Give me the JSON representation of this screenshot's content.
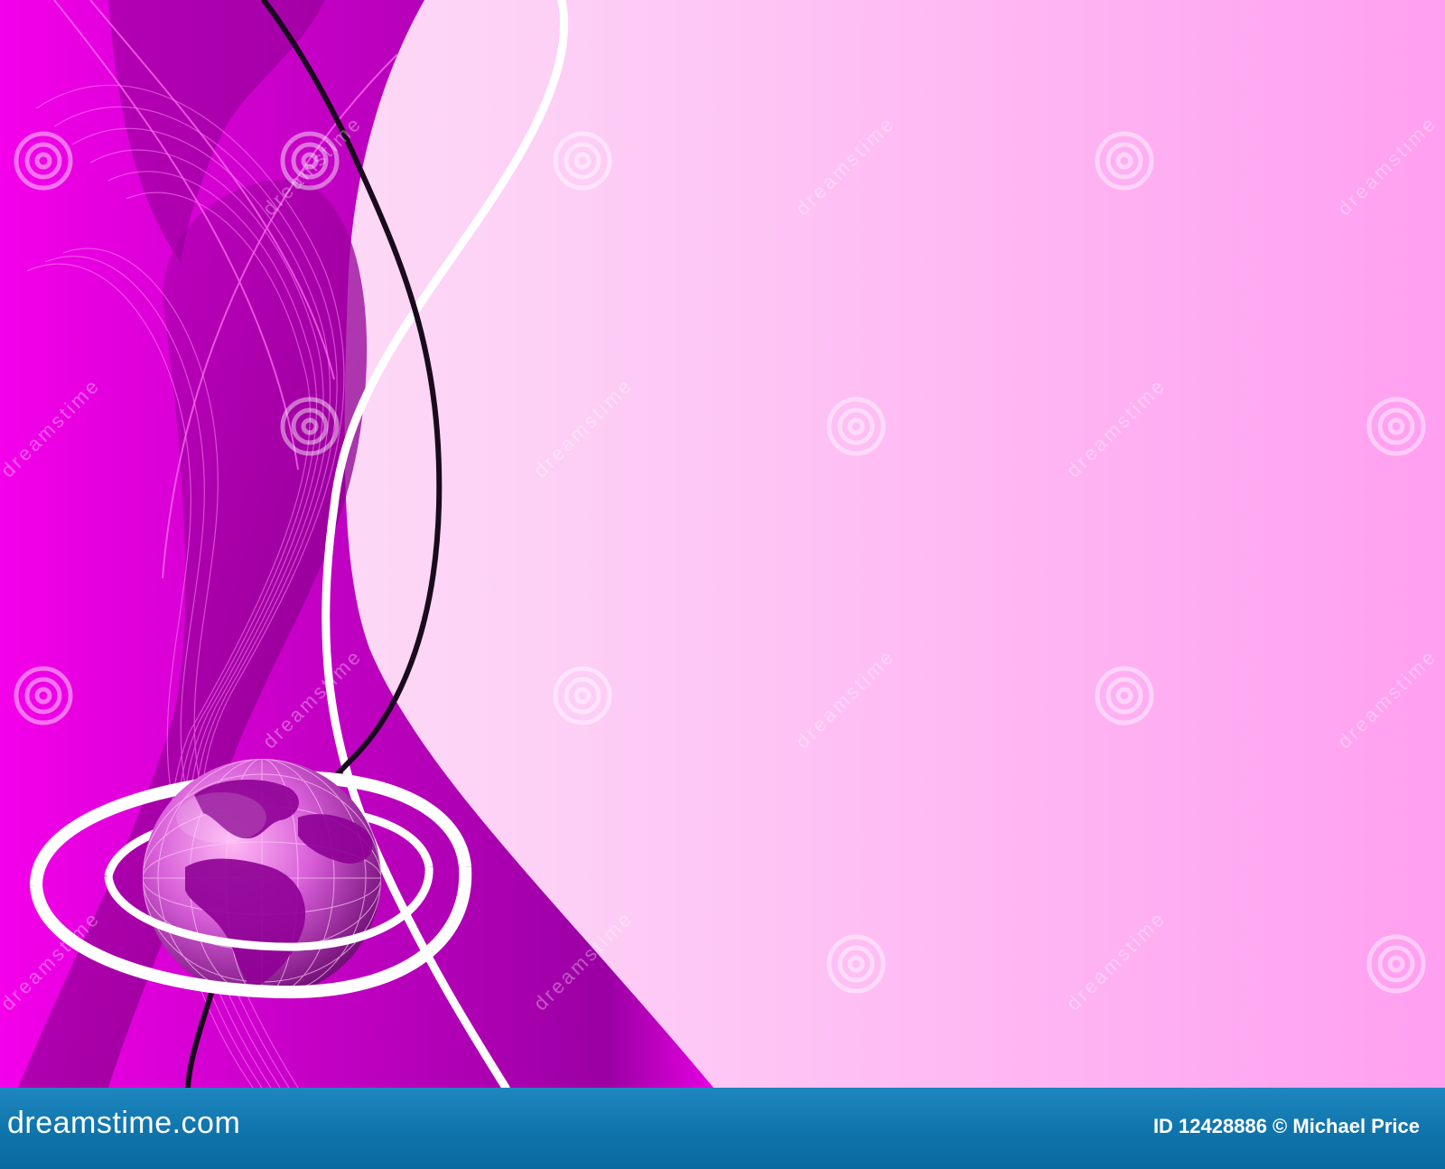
{
  "image": {
    "palette": {
      "background_light": "#fde6f8",
      "background_pink": "#ff9ff0",
      "magenta": "#f000e6",
      "deep_purple": "#7a007d",
      "ribbon_black": "#1a0a1e",
      "ribbon_white": "#ffffff"
    }
  },
  "watermark": {
    "text": "dreamstime"
  },
  "footer": {
    "logo": "dreamstime.com",
    "credit": "ID 12428886 © Michael Price",
    "colors": {
      "bar": "#0f74ab",
      "text": "#ffffff"
    }
  }
}
